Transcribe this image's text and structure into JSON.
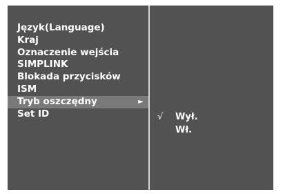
{
  "menu": {
    "items": [
      {
        "label": "Język(Language)"
      },
      {
        "label": "Kraj"
      },
      {
        "label": "Oznaczenie wejścia"
      },
      {
        "label": "SIMPLINK"
      },
      {
        "label": "Blokada przycisków"
      },
      {
        "label": "ISM"
      },
      {
        "label": "Tryb oszczędny",
        "selected": true,
        "arrow": "►"
      },
      {
        "label": "Set ID"
      }
    ]
  },
  "submenu": {
    "options": [
      {
        "label": "Wył.",
        "checked": true,
        "check": "√"
      },
      {
        "label": "Wł.",
        "checked": false
      }
    ]
  },
  "colors": {
    "background": "#525252",
    "highlight": "#7a7a7a",
    "divider": "#d8d8d8",
    "text": "#ffffff"
  }
}
